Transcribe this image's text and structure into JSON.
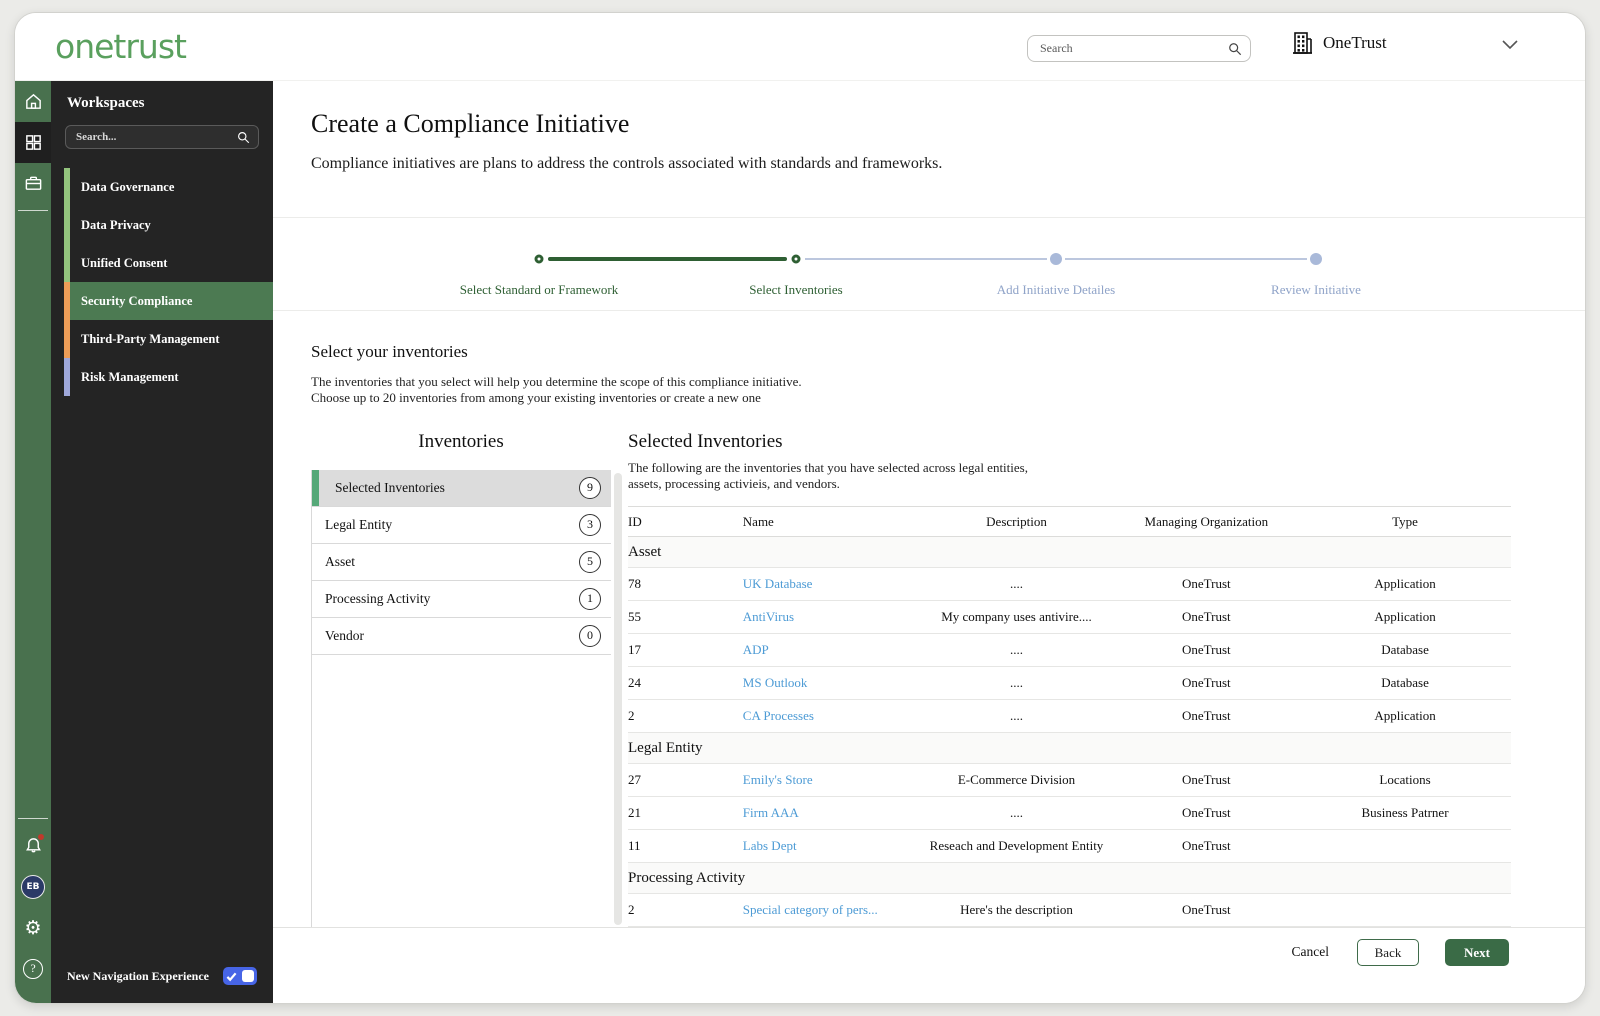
{
  "brand": {
    "logo_text": "onetrust",
    "logo_color": "#5aa05e"
  },
  "topbar": {
    "search_placeholder": "Search",
    "org_name": "OneTrust",
    "icons": [
      "search-icon",
      "building-icon",
      "chevron-down-icon"
    ]
  },
  "rail": {
    "top_icons": [
      "home-icon",
      "apps-grid-icon",
      "briefcase-icon"
    ],
    "active_icon": "apps-grid-icon",
    "bottom_icons": [
      "bell-icon",
      "avatar",
      "gear-icon",
      "help-icon"
    ],
    "avatar_initials": "EB",
    "avatar_color": "#2b3a67",
    "notification_dot_color": "#c0392b"
  },
  "workspaces": {
    "title": "Workspaces",
    "search_placeholder": "Search...",
    "items": [
      {
        "label": "Data Governance",
        "accent": "#93c47d",
        "selected": false
      },
      {
        "label": "Data Privacy",
        "accent": "#93c47d",
        "selected": false
      },
      {
        "label": "Unified Consent",
        "accent": "#93c47d",
        "selected": false
      },
      {
        "label": "Security Compliance",
        "accent": "#ed9d57",
        "selected": true
      },
      {
        "label": "Third-Party Management",
        "accent": "#ed9d57",
        "selected": false
      },
      {
        "label": "Risk Management",
        "accent": "#9fa8da",
        "selected": false
      }
    ],
    "selected_bg": "#4c7a52",
    "new_nav_label": "New Navigation Experience",
    "toggle": {
      "state": "on",
      "color": "#4765e6",
      "icons": [
        "check-icon"
      ]
    }
  },
  "page": {
    "title": "Create a Compliance Initiative",
    "subtitle": "Compliance initiatives are plans to address the controls associated with standards and frameworks."
  },
  "stepper": {
    "active_color": "#2e5f33",
    "upcoming_color": "#a9b9d9",
    "steps": [
      {
        "label": "Select Standard or Framework",
        "state": "done"
      },
      {
        "label": "Select Inventories",
        "state": "done"
      },
      {
        "label": "Add Initiative Detailes",
        "state": "upcoming"
      },
      {
        "label": "Review Initiative",
        "state": "upcoming"
      }
    ]
  },
  "section": {
    "heading": "Select your inventories",
    "desc_line1": "The inventories that you select will help you determine the scope of this compliance initiative.",
    "desc_line2": "Choose up to 20 inventories from among your existing inventories or create a new one"
  },
  "inventories": {
    "title": "Inventories",
    "items": [
      {
        "label": "Selected Inventories",
        "count": "9",
        "selected": true
      },
      {
        "label": "Legal Entity",
        "count": "3",
        "selected": false
      },
      {
        "label": "Asset",
        "count": "5",
        "selected": false
      },
      {
        "label": "Processing Activity",
        "count": "1",
        "selected": false
      },
      {
        "label": "Vendor",
        "count": "0",
        "selected": false
      }
    ]
  },
  "selected_panel": {
    "title": "Selected Inventories",
    "desc_line1": "The following are the inventories that you have selected across legal entities,",
    "desc_line2": "assets, processing activieis, and vendors.",
    "columns": [
      "ID",
      "Name",
      "Description",
      "Managing Organization",
      "Type"
    ],
    "link_color": "#4d9bd5",
    "groups": [
      {
        "name": "Asset",
        "rows": [
          {
            "id": "78",
            "name": "UK Database",
            "description": "....",
            "org": "OneTrust",
            "type": "Application"
          },
          {
            "id": "55",
            "name": "AntiVirus",
            "description": "My company uses antivire....",
            "org": "OneTrust",
            "type": "Application"
          },
          {
            "id": "17",
            "name": "ADP",
            "description": "....",
            "org": "OneTrust",
            "type": "Database"
          },
          {
            "id": "24",
            "name": "MS Outlook",
            "description": "....",
            "org": "OneTrust",
            "type": "Database"
          },
          {
            "id": "2",
            "name": "CA Processes",
            "description": "....",
            "org": "OneTrust",
            "type": "Application"
          }
        ]
      },
      {
        "name": "Legal Entity",
        "rows": [
          {
            "id": "27",
            "name": "Emily's Store",
            "description": "E-Commerce Division",
            "org": "OneTrust",
            "type": "Locations"
          },
          {
            "id": "21",
            "name": "Firm AAA",
            "description": "....",
            "org": "OneTrust",
            "type": "Business Patrner"
          },
          {
            "id": "11",
            "name": "Labs Dept",
            "description": "Reseach and Development Entity",
            "org": "OneTrust",
            "type": ""
          }
        ]
      },
      {
        "name": "Processing Activity",
        "rows": [
          {
            "id": "2",
            "name": "Special category of pers...",
            "description": "Here's the description",
            "org": "OneTrust",
            "type": ""
          }
        ]
      }
    ]
  },
  "footer": {
    "cancel_label": "Cancel",
    "back_label": "Back",
    "next_label": "Next"
  }
}
